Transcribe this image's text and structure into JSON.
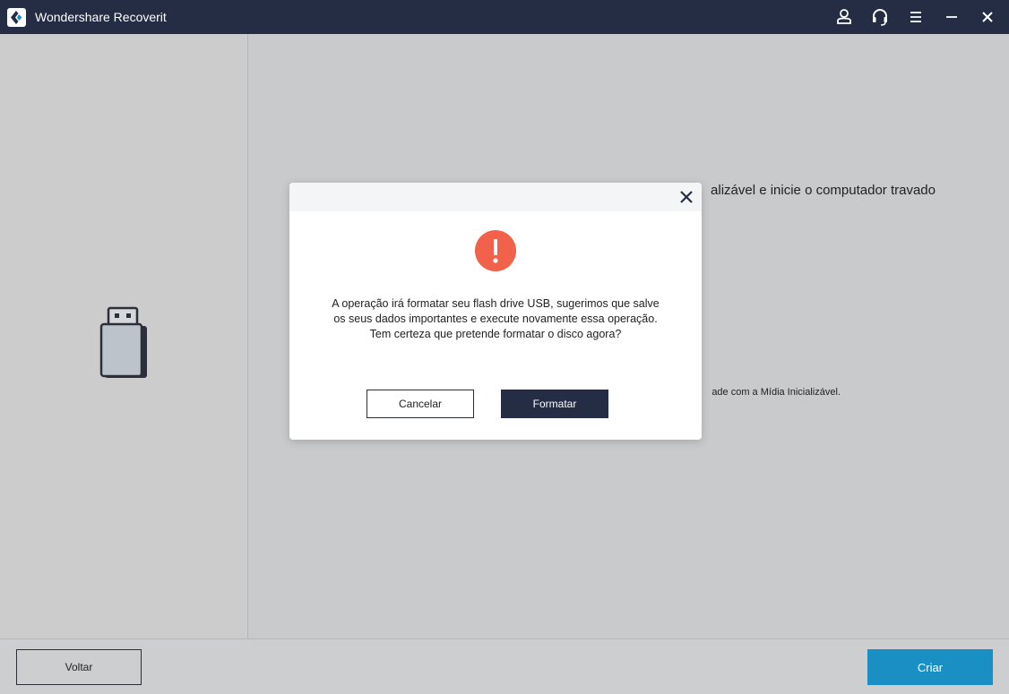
{
  "window": {
    "title": "Wondershare Recoverit",
    "icons": [
      "logo-icon",
      "account-icon",
      "support-headset-icon",
      "menu-icon",
      "minimize-icon",
      "close-icon"
    ]
  },
  "left_panel": {
    "icon": "usb-drive-icon"
  },
  "main": {
    "heading_fragment": "alizável e inicie o computador travado",
    "note_fragment": "ade com a Mídia Inicializável."
  },
  "dialog": {
    "icon": "warning-icon",
    "message_lines": [
      "A operação irá formatar seu flash drive USB, sugerimos que salve",
      "os seus dados importantes e execute novamente essa operação.",
      "Tem certeza que pretende formatar o disco agora?"
    ],
    "cancel_label": "Cancelar",
    "confirm_label": "Formatar"
  },
  "footer": {
    "back_label": "Voltar",
    "create_label": "Criar"
  },
  "colors": {
    "titlebar": "#242d44",
    "warning": "#f2614a",
    "primary_button": "#242d44",
    "accent_button": "#1a8fc3"
  }
}
